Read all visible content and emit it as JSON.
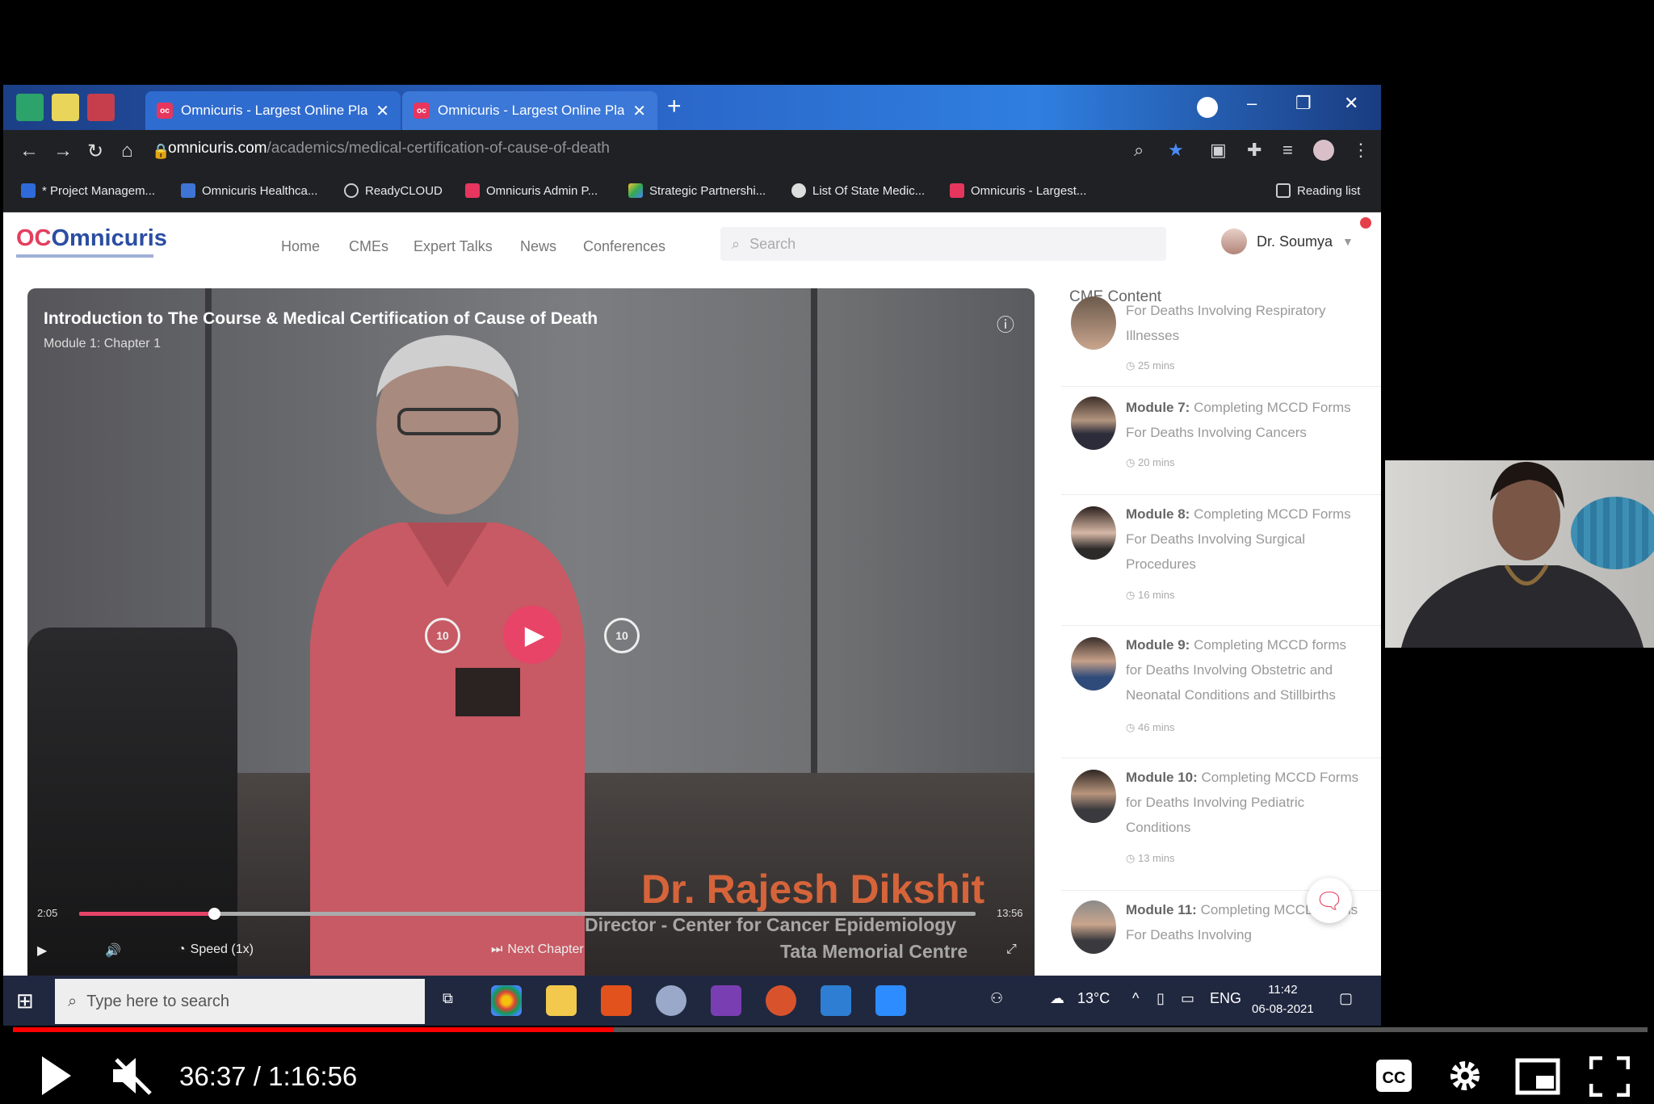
{
  "browser": {
    "tabs": [
      {
        "title": "Omnicuris - Largest Online Platf",
        "active": false
      },
      {
        "title": "Omnicuris - Largest Online Platf",
        "active": true
      }
    ],
    "url_host": "omnicuris.com",
    "url_path": "/academics/medical-certification-of-cause-of-death",
    "bookmarks": [
      "* Project Managem...",
      "Omnicuris Healthca...",
      "ReadyCLOUD",
      "Omnicuris Admin P...",
      "Strategic Partnershi...",
      "List Of State Medic...",
      "Omnicuris - Largest..."
    ],
    "reading_list": "Reading list"
  },
  "site": {
    "logo": "Omnicuris",
    "logo_mark": "OC",
    "nav": [
      "Home",
      "CMEs",
      "Expert Talks",
      "News",
      "Conferences"
    ],
    "search_placeholder": "Search",
    "user_name": "Dr. Soumya"
  },
  "video": {
    "title": "Introduction to The Course & Medical Certification of Cause of Death",
    "subtitle": "Module 1: Chapter 1",
    "speaker_name": "Dr. Rajesh Dikshit",
    "speaker_role": "Director - Center for Cancer Epidemiology",
    "speaker_org": "Tata Memorial Centre",
    "current_time": "2:05",
    "total_time": "13:56",
    "progress": 0.15,
    "speed_label": "Speed (1x)",
    "next_label": "Next Chapter",
    "rewind_label": "10",
    "forward_label": "10"
  },
  "cme": {
    "heading": "CME Content",
    "items": [
      {
        "module": "",
        "title": "For Deaths Involving Respiratory Illnesses",
        "duration": "25 mins"
      },
      {
        "module": "Module 7:",
        "title": "Completing MCCD Forms For Deaths Involving Cancers",
        "duration": "20 mins"
      },
      {
        "module": "Module 8:",
        "title": "Completing MCCD Forms For Deaths Involving Surgical Procedures",
        "duration": "16 mins"
      },
      {
        "module": "Module 9:",
        "title": "Completing MCCD forms for Deaths Involving Obstetric and Neonatal Conditions and Stillbirths",
        "duration": "46 mins"
      },
      {
        "module": "Module 10:",
        "title": "Completing MCCD Forms for Deaths Involving Pediatric Conditions",
        "duration": "13 mins"
      },
      {
        "module": "Module 11:",
        "title": "Completing MCCD Forms For Deaths Involving",
        "duration": ""
      }
    ]
  },
  "taskbar": {
    "search_placeholder": "Type here to search",
    "temperature": "13°C",
    "language": "ENG",
    "time": "11:42",
    "date": "06-08-2021"
  },
  "youtube": {
    "time_display": "36:37 / 1:16:56",
    "progress": 0.3677
  },
  "colors": {
    "accent": "#e84467",
    "brand_blue": "#2b4ea2",
    "yt_red": "#ff0000"
  }
}
